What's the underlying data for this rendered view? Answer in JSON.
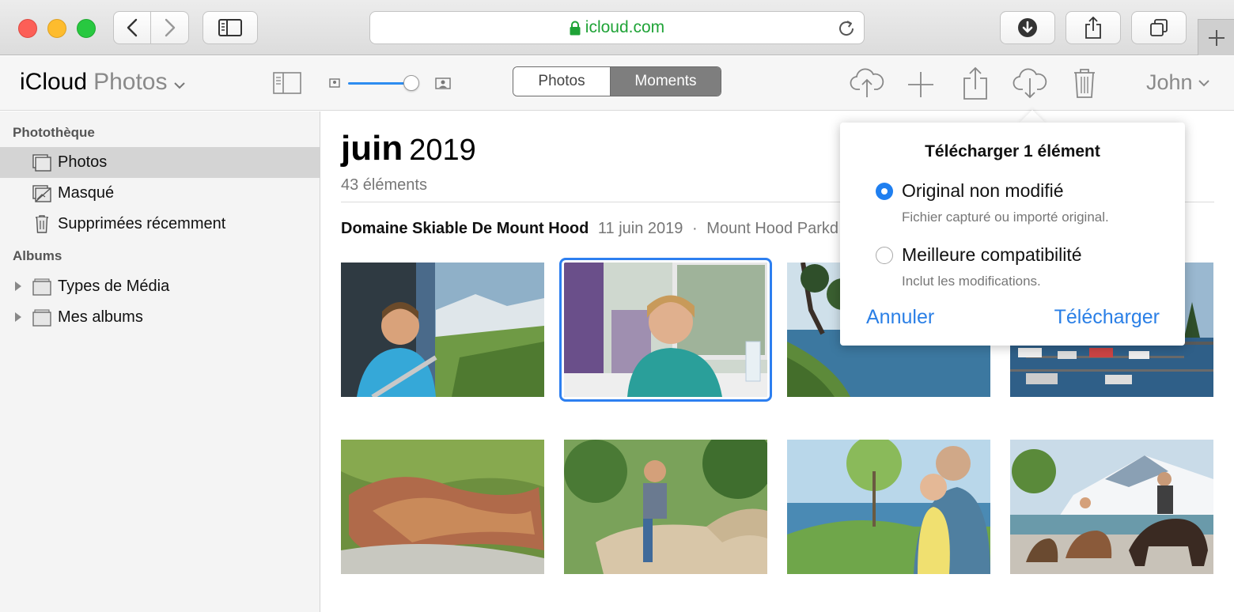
{
  "browser": {
    "url": "icloud.com",
    "icons": {
      "back": "chevron-left-icon",
      "forward": "chevron-right-icon",
      "sidebar": "sidebar-icon",
      "lock": "lock-icon",
      "reload": "reload-icon",
      "downloads": "download-arrow-icon",
      "share": "share-icon",
      "tabs": "tabs-icon",
      "new_tab": "plus-icon"
    }
  },
  "app": {
    "brand": "iCloud",
    "product": "Photos",
    "view_toggle": {
      "photos": "Photos",
      "moments": "Moments",
      "selected": "Moments"
    },
    "user": "John",
    "thumbnail_size_level": 0.8
  },
  "sidebar": {
    "library_header": "Photothèque",
    "library_items": [
      {
        "label": "Photos",
        "icon": "photos-stack-icon",
        "selected": true
      },
      {
        "label": "Masqué",
        "icon": "hidden-photo-icon",
        "selected": false
      },
      {
        "label": "Supprimées récemment",
        "icon": "trash-icon",
        "selected": false
      }
    ],
    "albums_header": "Albums",
    "album_items": [
      {
        "label": "Types de Média",
        "icon": "album-folder-icon"
      },
      {
        "label": "Mes albums",
        "icon": "album-folder-icon"
      }
    ]
  },
  "main": {
    "month": "juin",
    "year": "2019",
    "count": "43 éléments",
    "moment": {
      "place": "Domaine Skiable De Mount Hood",
      "date": "11 juin 2019",
      "separator": "·",
      "location": "Mount Hood Parkd"
    }
  },
  "popover": {
    "title": "Télécharger 1 élément",
    "options": [
      {
        "label": "Original non modifié",
        "description": "Fichier capturé ou importé original.",
        "selected": true
      },
      {
        "label": "Meilleure compatibilité",
        "description": "Inclut les modifications.",
        "selected": false
      }
    ],
    "cancel": "Annuler",
    "confirm": "Télécharger"
  },
  "colors": {
    "accent": "#2a7fe6",
    "url_green": "#1fa337",
    "segment_selected": "#7e7e7e"
  }
}
